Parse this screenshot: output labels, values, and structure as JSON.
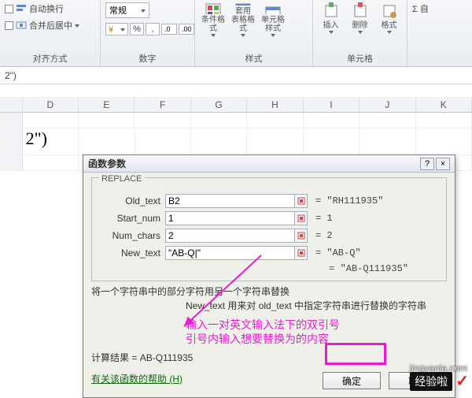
{
  "ribbon": {
    "align_group": "对齐方式",
    "wrap": "自动换行",
    "merge": "合并后居中",
    "number_group": "数字",
    "num_format": "常规",
    "style_group": "样式",
    "cond_format": "条件格式",
    "table_format": "套用\n表格格式",
    "cell_style": "单元格样式",
    "cells_group": "单元格",
    "insert": "插入",
    "delete": "删除",
    "format": "格式",
    "sigma": "Σ 自"
  },
  "formula_bar": "2\")",
  "columns": [
    "",
    "D",
    "E",
    "F",
    "G",
    "H",
    "I",
    "J",
    "K"
  ],
  "visible_cell": "2\")",
  "dialog": {
    "title": "函数参数",
    "fn_name": "REPLACE",
    "params": {
      "old_text": {
        "label": "Old_text",
        "value": "B2",
        "eq": "= \"RH111935\""
      },
      "start_num": {
        "label": "Start_num",
        "value": "1",
        "eq": "= 1"
      },
      "num_chars": {
        "label": "Num_chars",
        "value": "2",
        "eq": "= 2"
      },
      "new_text": {
        "label": "New_text",
        "value": "\"AB-Q|\"",
        "eq": "= \"AB-Q\""
      }
    },
    "result_eq": "= \"AB-Q111935\"",
    "desc_main": "将一个字符串中的部分字符用另一个字符串替换",
    "desc_sub": "New_text 用来对 old_text 中指定字符串进行替换的字符串",
    "annot1": "输入一对英文输入法下的双引号",
    "annot2": "引号内输入想要替换为的内容",
    "calc_result_label": "计算结果 = ",
    "calc_result_value": "AB-Q111935",
    "help_link": "有关该函数的帮助 (H)",
    "ok": "确定",
    "cancel": "取消"
  },
  "watermark": {
    "brand": "经验啦",
    "url": "jingyanla.com"
  }
}
